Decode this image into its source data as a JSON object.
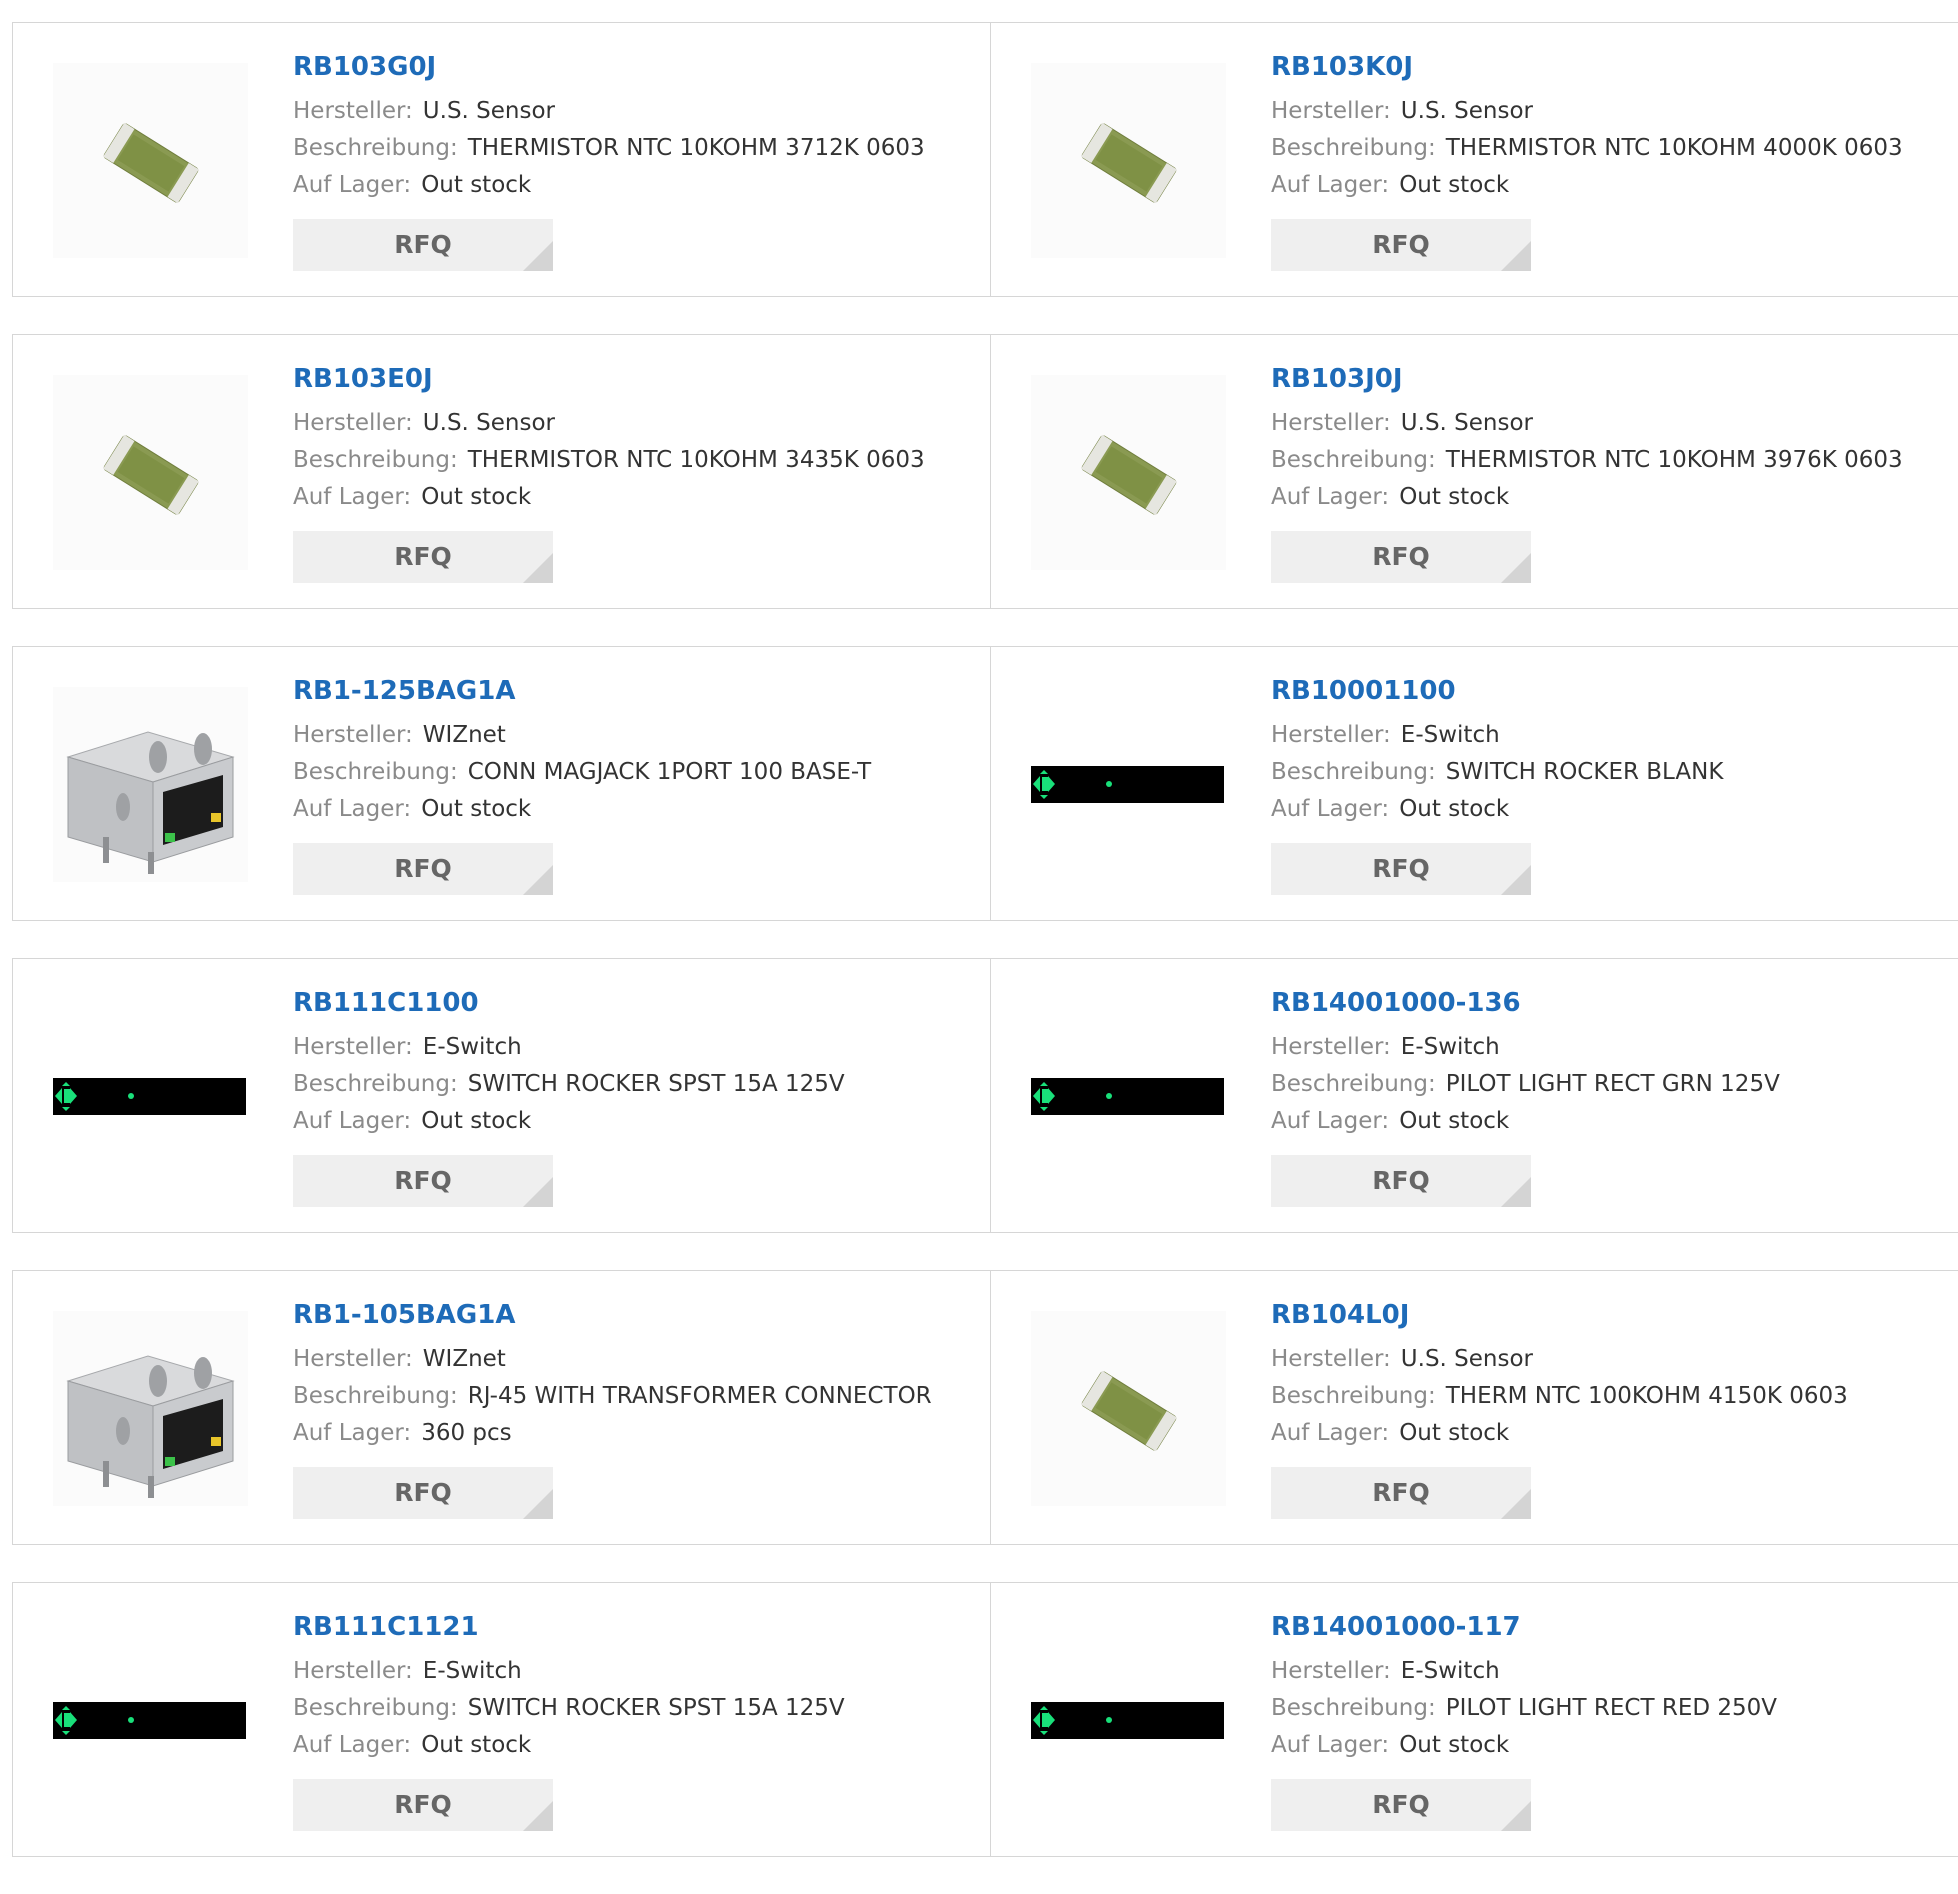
{
  "labels": {
    "manufacturer": "Hersteller:",
    "description": "Beschreibung:",
    "stock": "Auf Lager:",
    "rfq": "RFQ"
  },
  "products": [
    {
      "part": "RB103G0J",
      "manufacturer": "U.S. Sensor",
      "description": "THERMISTOR NTC 10KOHM 3712K 0603",
      "stock": "Out stock",
      "image": "thermistor-chip"
    },
    {
      "part": "RB103K0J",
      "manufacturer": "U.S. Sensor",
      "description": "THERMISTOR NTC 10KOHM 4000K 0603",
      "stock": "Out stock",
      "image": "thermistor-chip"
    },
    {
      "part": "RB103E0J",
      "manufacturer": "U.S. Sensor",
      "description": "THERMISTOR NTC 10KOHM 3435K 0603",
      "stock": "Out stock",
      "image": "thermistor-chip"
    },
    {
      "part": "RB103J0J",
      "manufacturer": "U.S. Sensor",
      "description": "THERMISTOR NTC 10KOHM 3976K 0603",
      "stock": "Out stock",
      "image": "thermistor-chip"
    },
    {
      "part": "RB1-125BAG1A",
      "manufacturer": "WIZnet",
      "description": "CONN MAGJACK 1PORT 100 BASE-T",
      "stock": "Out stock",
      "image": "rj45-jack"
    },
    {
      "part": "RB10001100",
      "manufacturer": "E-Switch",
      "description": "SWITCH ROCKER BLANK",
      "stock": "Out stock",
      "image": "placeholder-bar"
    },
    {
      "part": "RB111C1100",
      "manufacturer": "E-Switch",
      "description": "SWITCH ROCKER SPST 15A 125V",
      "stock": "Out stock",
      "image": "placeholder-bar"
    },
    {
      "part": "RB14001000-136",
      "manufacturer": "E-Switch",
      "description": "PILOT LIGHT RECT GRN 125V",
      "stock": "Out stock",
      "image": "placeholder-bar"
    },
    {
      "part": "RB1-105BAG1A",
      "manufacturer": "WIZnet",
      "description": "RJ-45 WITH TRANSFORMER CONNECTOR",
      "stock": "360 pcs",
      "image": "rj45-jack"
    },
    {
      "part": "RB104L0J",
      "manufacturer": "U.S. Sensor",
      "description": "THERM NTC 100KOHM 4150K 0603",
      "stock": "Out stock",
      "image": "thermistor-chip"
    },
    {
      "part": "RB111C1121",
      "manufacturer": "E-Switch",
      "description": "SWITCH ROCKER SPST 15A 125V",
      "stock": "Out stock",
      "image": "placeholder-bar"
    },
    {
      "part": "RB14001000-117",
      "manufacturer": "E-Switch",
      "description": "PILOT LIGHT RECT RED 250V",
      "stock": "Out stock",
      "image": "placeholder-bar"
    }
  ],
  "colors": {
    "part_link": "#1e6bb8",
    "label": "#8a8a8a",
    "value": "#333333",
    "rfq_bg": "#efefef",
    "border": "#d6d6d6",
    "placeholder_icon": "#19e07a"
  }
}
